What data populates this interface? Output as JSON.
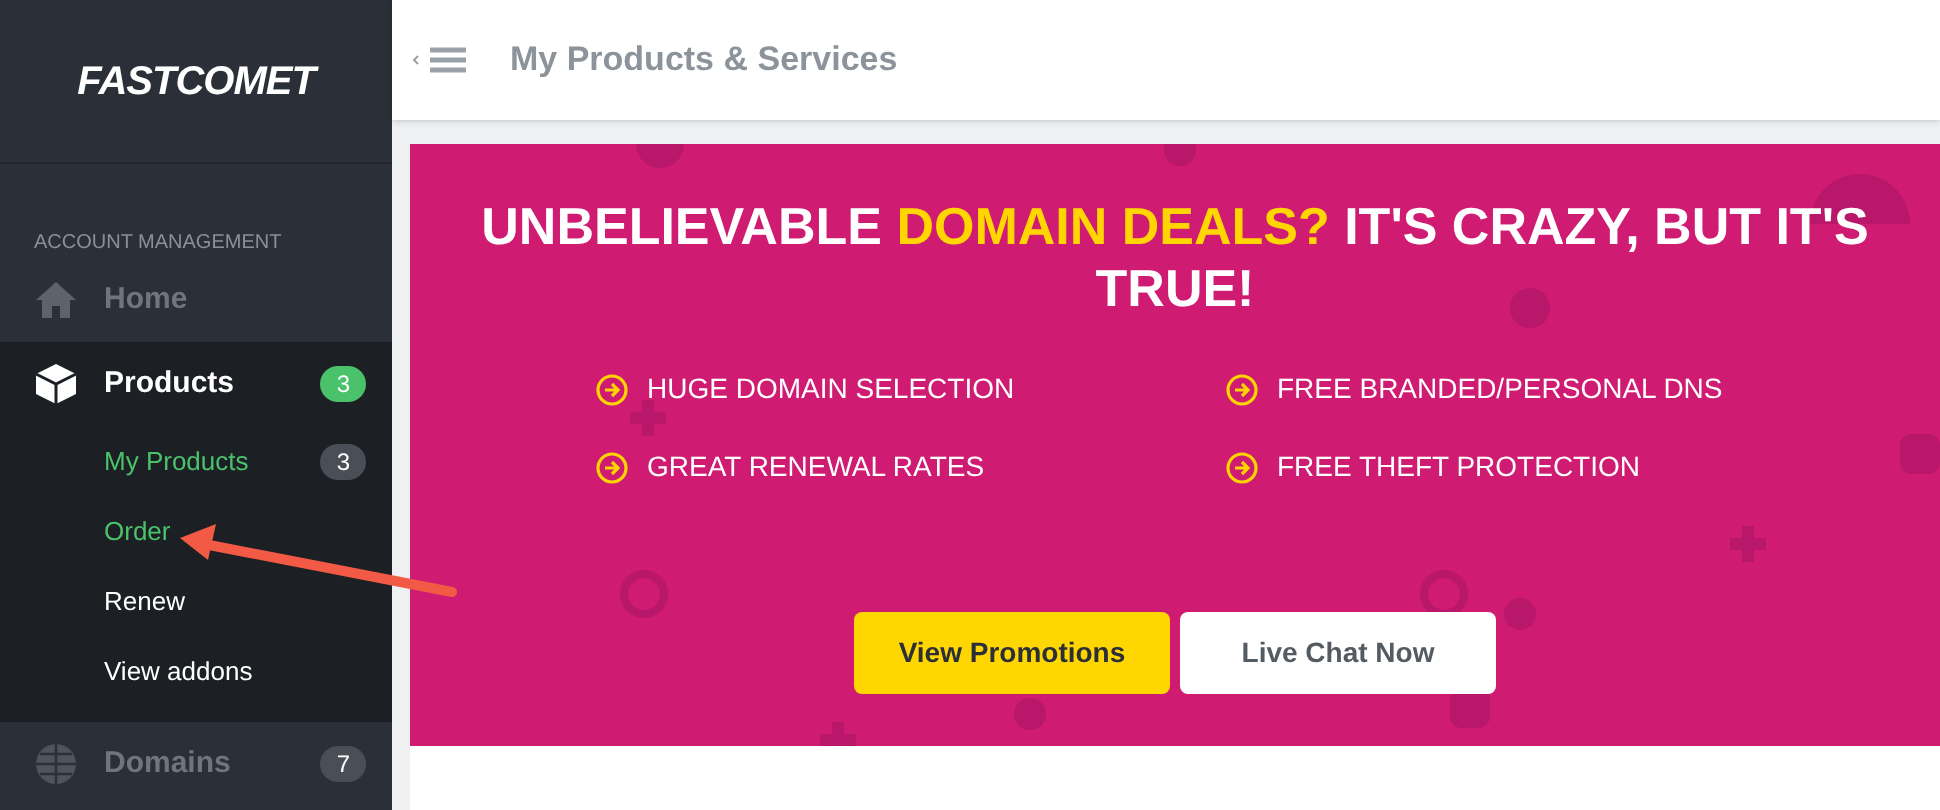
{
  "logo": "FASTCOMET",
  "sidebar": {
    "section_title": "ACCOUNT MANAGEMENT",
    "items": [
      {
        "label": "Home",
        "kind": "home",
        "expanded": false
      },
      {
        "label": "Products",
        "kind": "box",
        "expanded": true,
        "badge": "3",
        "color": "#4ac26b",
        "children": [
          {
            "label": "My Products",
            "active": true,
            "badge": "3"
          },
          {
            "label": "Order",
            "active": true
          },
          {
            "label": "Renew",
            "active": false
          },
          {
            "label": "View addons",
            "active": false
          }
        ]
      },
      {
        "label": "Domains",
        "kind": "globe",
        "expanded": false,
        "badge": "7",
        "color": "#4a4f57"
      }
    ]
  },
  "header": {
    "title": "My Products & Services"
  },
  "banner": {
    "headline": [
      {
        "text": "UNBELIEVABLE ",
        "highlight": false
      },
      {
        "text": "DOMAIN DEALS?",
        "highlight": true
      },
      {
        "text": " IT'S CRAZY, BUT IT'S TRUE!",
        "highlight": false
      }
    ],
    "features": [
      "HUGE DOMAIN SELECTION",
      "FREE BRANDED/PERSONAL DNS",
      "GREAT RENEWAL RATES",
      "FREE THEFT PROTECTION"
    ],
    "buttons": [
      {
        "label": "View Promotions",
        "kind": "primary"
      },
      {
        "label": "Live Chat Now",
        "kind": "secondary"
      }
    ]
  }
}
